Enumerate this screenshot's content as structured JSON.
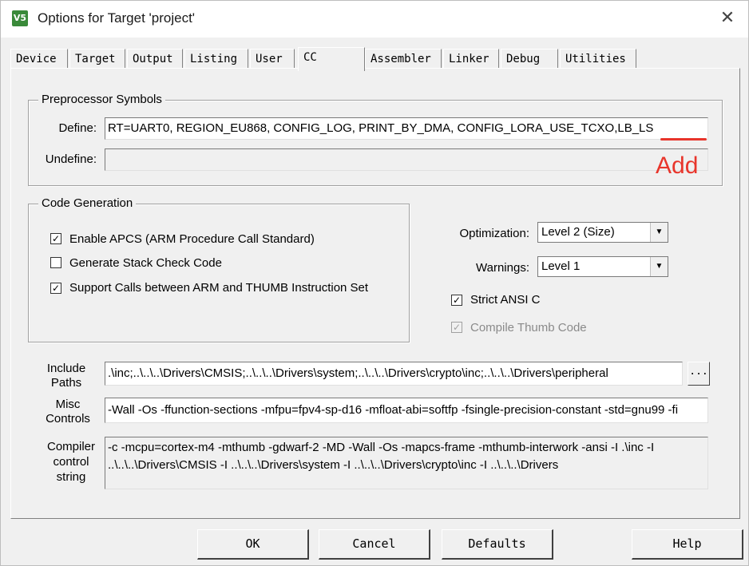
{
  "window": {
    "title": "Options for Target 'project'",
    "icon_text": "V5"
  },
  "tabs": [
    "Device",
    "Target",
    "Output",
    "Listing",
    "User",
    "CC",
    "Assembler",
    "Linker",
    "Debug",
    "Utilities"
  ],
  "active_tab": "CC",
  "preprocessor": {
    "group_label": "Preprocessor Symbols",
    "define_label": "Define:",
    "define_value": "RT=UART0,  REGION_EU868,  CONFIG_LOG,  PRINT_BY_DMA, CONFIG_LORA_USE_TCXO,LB_LS",
    "undefine_label": "Undefine:",
    "undefine_value": "",
    "annotation": "Add",
    "annotation_color": "#e8352b"
  },
  "code_generation": {
    "group_label": "Code Generation",
    "options": [
      {
        "label": "Enable APCS (ARM Procedure Call Standard)",
        "checked": true
      },
      {
        "label": "Generate Stack Check Code",
        "checked": false
      },
      {
        "label": "Support Calls between ARM and THUMB Instruction Set",
        "checked": true
      }
    ]
  },
  "optimization": {
    "label": "Optimization:",
    "value": "Level 2 (Size)"
  },
  "warnings": {
    "label": "Warnings:",
    "value": "Level 1"
  },
  "strict_ansi": {
    "label": "Strict ANSI C",
    "checked": true
  },
  "compile_thumb": {
    "label": "Compile Thumb Code",
    "checked": true,
    "disabled": true
  },
  "include_paths": {
    "label_line1": "Include",
    "label_line2": "Paths",
    "value": ".\\inc;..\\..\\..\\Drivers\\CMSIS;..\\..\\..\\Drivers\\system;..\\..\\..\\Drivers\\crypto\\inc;..\\..\\..\\Drivers\\peripheral",
    "browse_label": "..."
  },
  "misc_controls": {
    "label_line1": "Misc",
    "label_line2": "Controls",
    "value": "-Wall -Os -ffunction-sections -mfpu=fpv4-sp-d16 -mfloat-abi=softfp -fsingle-precision-constant -std=gnu99 -fi"
  },
  "compiler_control": {
    "label_line1": "Compiler",
    "label_line2": "control",
    "label_line3": "string",
    "line1": "-c -mcpu=cortex-m4 -mthumb -gdwarf-2 -MD -Wall -Os -mapcs-frame -mthumb-interwork -ansi -I .\\inc -I",
    "line2": "..\\..\\..\\Drivers\\CMSIS -I ..\\..\\..\\Drivers\\system -I ..\\..\\..\\Drivers\\crypto\\inc -I ..\\..\\..\\Drivers"
  },
  "buttons": {
    "ok": "OK",
    "cancel": "Cancel",
    "defaults": "Defaults",
    "help": "Help"
  }
}
